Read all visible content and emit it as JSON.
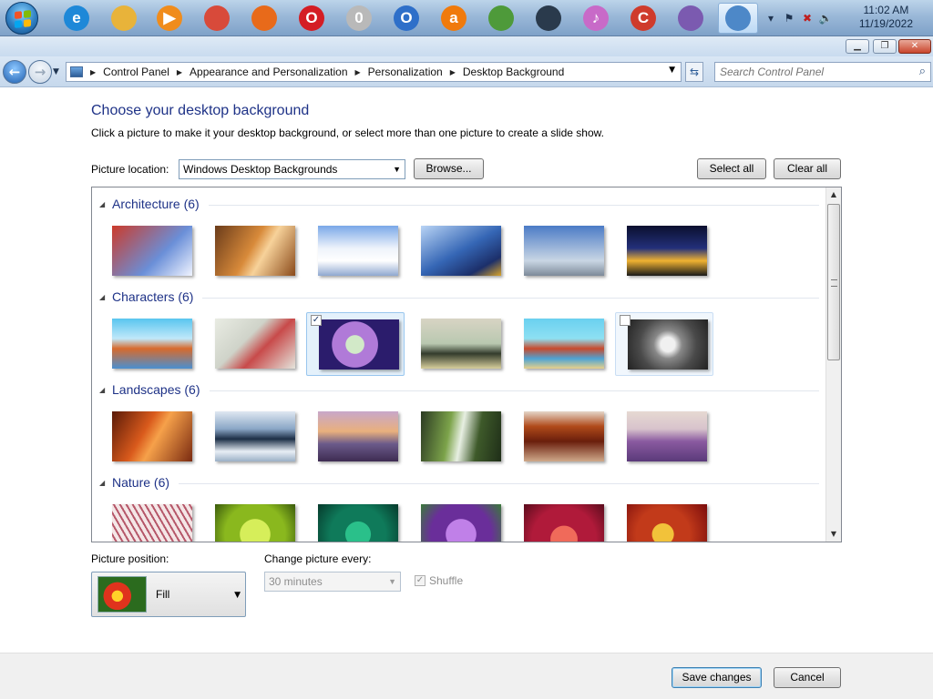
{
  "taskbar": {
    "apps": [
      {
        "name": "internet-explorer-icon",
        "glyph": "e",
        "color": "#1e88d8"
      },
      {
        "name": "windows-explorer-icon",
        "glyph": "",
        "color": "#e8b33a"
      },
      {
        "name": "media-player-icon",
        "glyph": "▶",
        "color": "#f08c1c"
      },
      {
        "name": "chrome-icon",
        "glyph": "",
        "color": "#d84a3a"
      },
      {
        "name": "firefox-icon",
        "glyph": "",
        "color": "#e86a1a"
      },
      {
        "name": "opera-icon",
        "glyph": "O",
        "color": "#d41d24"
      },
      {
        "name": "opera-next-icon",
        "glyph": "0",
        "color": "#b9b9b9"
      },
      {
        "name": "outlook-icon",
        "glyph": "O",
        "color": "#2e6fc9"
      },
      {
        "name": "avast-icon",
        "glyph": "a",
        "color": "#f07a0c"
      },
      {
        "name": "globe-icon",
        "glyph": "",
        "color": "#4e9a3a"
      },
      {
        "name": "steam-icon",
        "glyph": "",
        "color": "#2a3a4c"
      },
      {
        "name": "itunes-icon",
        "glyph": "♪",
        "color": "#c86ac8"
      },
      {
        "name": "ccleaner-icon",
        "glyph": "C",
        "color": "#cf3b2c"
      },
      {
        "name": "cyberlink-icon",
        "glyph": "",
        "color": "#7b5ab0"
      },
      {
        "name": "control-panel-icon",
        "glyph": "",
        "color": "#4d88c8"
      }
    ],
    "clock": {
      "time": "11:02 AM",
      "date": "11/19/2022"
    }
  },
  "address": {
    "crumbs": [
      "Control Panel",
      "Appearance and Personalization",
      "Personalization",
      "Desktop Background"
    ],
    "search_placeholder": "Search Control Panel"
  },
  "page": {
    "title": "Choose your desktop background",
    "description": "Click a picture to make it your desktop background, or select more than one picture to create a slide show.",
    "location_label": "Picture location:",
    "location_value": "Windows Desktop Backgrounds",
    "browse_label": "Browse...",
    "select_all_label": "Select all",
    "clear_all_label": "Clear all"
  },
  "groups": [
    {
      "name": "Architecture (6)",
      "thumbs": [
        {
          "bg": "linear-gradient(135deg,#cc3a2a,#6a8fd8 60%,#f0f4ff)"
        },
        {
          "bg": "linear-gradient(120deg,#6a3b1a,#d88a3a 45%,#f7d29a 60%,#8a4a1a)"
        },
        {
          "bg": "linear-gradient(180deg,#7aa8e8 0%,#eef3fb 45%,#ffffff 70%,#8fa8d0 100%)"
        },
        {
          "bg": "linear-gradient(150deg,#b9d4f5,#3566b5 50%,#1c2f6a 80%,#d9a42a)"
        },
        {
          "bg": "linear-gradient(180deg,#4b7bc6,#c9d6e4 70%,#7d8a99)"
        },
        {
          "bg": "linear-gradient(180deg,#0b0f2e 0%,#23307a 45%,#f0b231 70%,#1a1a1a 100%)"
        }
      ]
    },
    {
      "name": "Characters (6)",
      "thumbs": [
        {
          "bg": "linear-gradient(180deg,#58c5ef,#c0e8f9 40%,#d76a2c 60%,#4a8fd0)"
        },
        {
          "bg": "linear-gradient(135deg,#e9ece3,#cfd3c9 40%,#c84a4a 60%,#e4e4dc)"
        },
        {
          "bg": "radial-gradient(circle at 45% 50%,#d2e9c8 0 18%,#b07ad8 19% 45%,#2b1c6c 46%)",
          "selected": true
        },
        {
          "bg": "linear-gradient(180deg,#d8d4c4,#b9c8b0 50%,#333b2c 70%,#d7ce9c)"
        },
        {
          "bg": "linear-gradient(180deg,#6ad0f0 0%,#8ee0f2 40%,#c84a2c 60%,#4da3d4 80%,#e8d08a)"
        },
        {
          "bg": "radial-gradient(circle at 50% 50%,#f0f0f0 0 15%,#888 30%,#4a4a4a 60%,#222)",
          "hover": true
        }
      ]
    },
    {
      "name": "Landscapes (6)",
      "thumbs": [
        {
          "bg": "linear-gradient(120deg,#5a1a08,#d95a1c 40%,#f6a14a 55%,#7a2a10)"
        },
        {
          "bg": "linear-gradient(180deg,#dfe7f1 0%,#8aa6c6 35%,#1c2e46 55%,#e7eef5 80%,#9bb0c6)"
        },
        {
          "bg": "linear-gradient(180deg,#c8a7c9 0%,#e9b07d 40%,#6b5a8a 65%,#3e2c52)"
        },
        {
          "bg": "linear-gradient(100deg,#2b3a22,#7ca34a 35%,#e7efe2 50%,#3e5a2a 70%,#1f2e18)"
        },
        {
          "bg": "linear-gradient(180deg,#e4d6c8 0%,#b04a1a 30%,#6a1e0c 60%,#cfa98a)"
        },
        {
          "bg": "linear-gradient(180deg,#e6d9d2 0%,#d8c3cc 35%,#8a5aa0 60%,#5a3a7a)"
        }
      ]
    },
    {
      "name": "Nature (6)",
      "thumbs": [
        {
          "bg": "repeating-linear-gradient(60deg,#f4e6e6 0 4px,#b6586a 4px 6px)"
        },
        {
          "bg": "radial-gradient(circle at 50% 60%,#d6ee5a 0 30%,#8ab81e 31% 60%,#3a5a0c)"
        },
        {
          "bg": "radial-gradient(circle at 50% 60%,#2ac08a 0 25%,#0f7a5a 26% 55%,#063a2c)"
        },
        {
          "bg": "radial-gradient(circle at 50% 60%,#c080e8 0 30%,#6a2e9a 31% 60%,#3a7a3a)"
        },
        {
          "bg": "radial-gradient(circle at 50% 70%,#f06a5a 0 25%,#b01a3a 26% 60%,#5a0c1c)"
        },
        {
          "bg": "radial-gradient(circle at 45% 60%,#f2c23a 0 20%,#c23a1a 21% 50%,#7a0c0c)"
        }
      ]
    }
  ],
  "bottom": {
    "position_label": "Picture position:",
    "position_value": "Fill",
    "change_label": "Change picture every:",
    "change_value": "30 minutes",
    "shuffle_label": "Shuffle"
  },
  "footer": {
    "save_label": "Save changes",
    "cancel_label": "Cancel"
  }
}
